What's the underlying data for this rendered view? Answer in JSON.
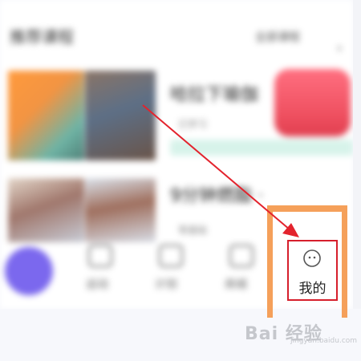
{
  "app": {
    "section_title": "推荐课程",
    "section_more": "全部课程",
    "courses": [
      {
        "title": "哈拉下瑜伽",
        "meta": "已学习"
      },
      {
        "title": "9分钟燃脂 ·",
        "meta": "零基础"
      }
    ]
  },
  "tab_bar": {
    "tabs": [
      {
        "label": ""
      },
      {
        "label": "运动"
      },
      {
        "label": "计划"
      },
      {
        "label": "商城"
      },
      {
        "label": "我的"
      }
    ]
  },
  "annotation": {
    "arrow_color": "#e3232d",
    "highlight_color": "#d61f2c",
    "frame_color": "#f5a05a"
  },
  "watermark": {
    "text": "Bai 经验",
    "sub": "jingyan.baidu.com"
  },
  "colors": {
    "accent": "#7b68ee",
    "promo": "#ee4f5f"
  }
}
